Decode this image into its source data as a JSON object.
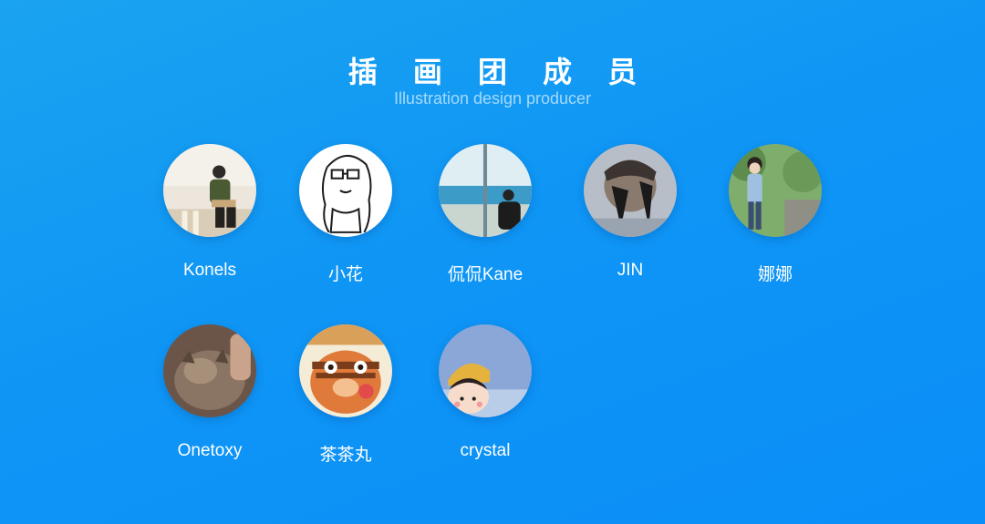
{
  "header": {
    "title": "插 画 团 成 员",
    "subtitle": "Illustration design producer"
  },
  "members": [
    {
      "name": "Konels"
    },
    {
      "name": "小花"
    },
    {
      "name": "侃侃Kane"
    },
    {
      "name": "JIN"
    },
    {
      "name": "娜娜"
    },
    {
      "name": "Onetoxy"
    },
    {
      "name": "茶茶丸"
    },
    {
      "name": "crystal"
    }
  ],
  "colors": {
    "background_start": "#1aa3f0",
    "background_end": "#0a8ef8",
    "text": "#ffffff"
  }
}
